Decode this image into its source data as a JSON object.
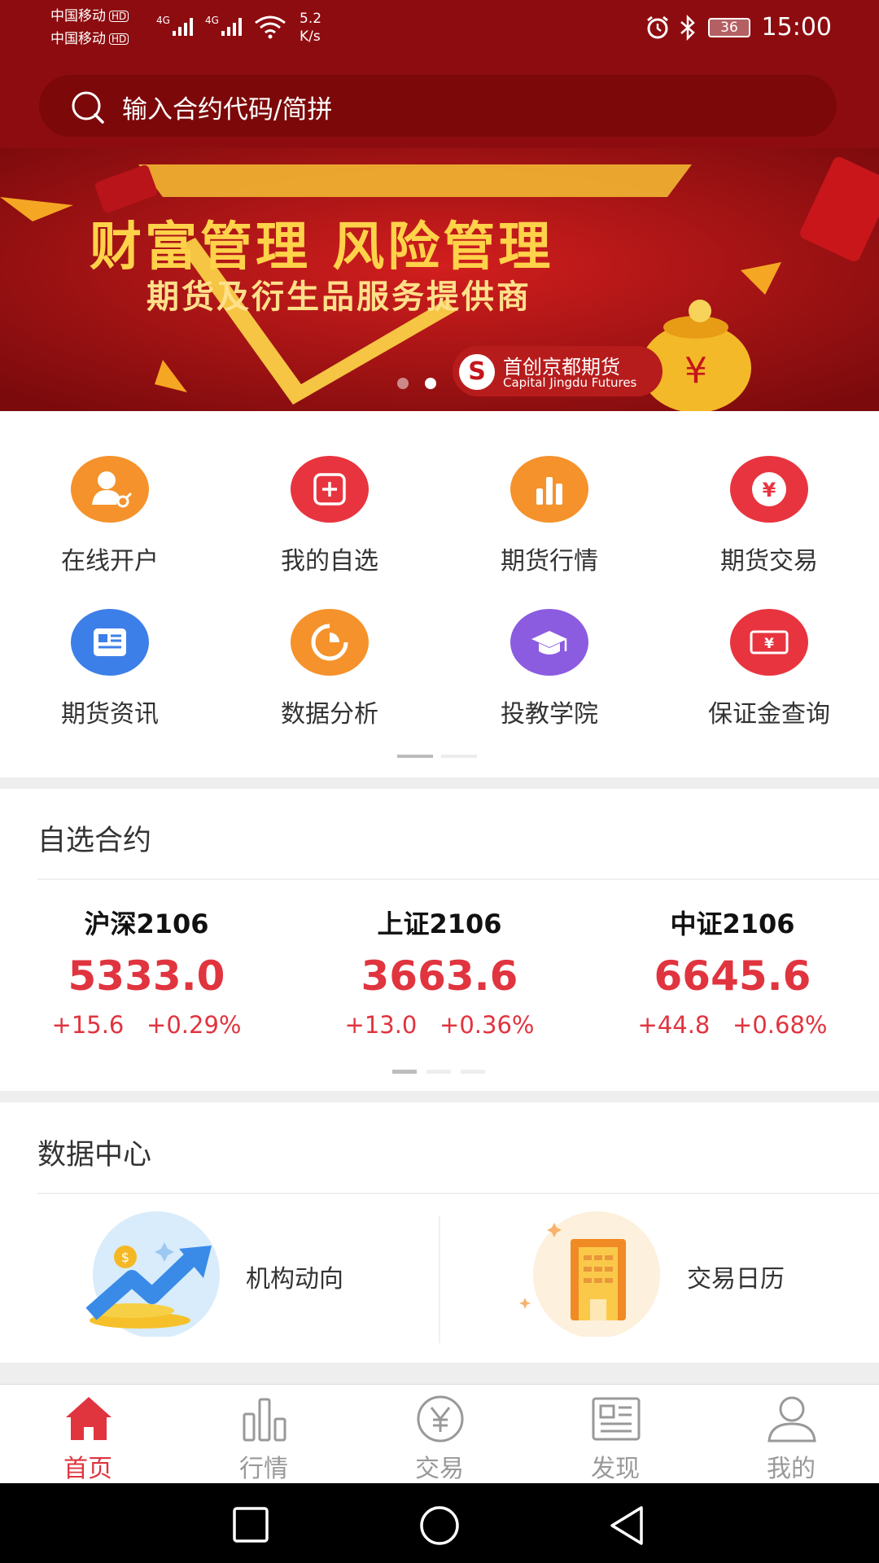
{
  "status_bar": {
    "carrier1": "中国移动",
    "carrier2": "中国移动",
    "hd": "HD",
    "net1": "4G",
    "net2": "4G",
    "speed": "5.2",
    "speed_unit": "K/s",
    "battery": "36",
    "time": "15:00"
  },
  "search": {
    "placeholder": "输入合约代码/简拼"
  },
  "banner": {
    "title": "财富管理 风险管理",
    "subtitle": "期货及衍生品服务提供商",
    "logo_cn": "首创京都期货",
    "logo_en": "Capital Jingdu Futures",
    "logo_mark": "S",
    "total_slides": 2,
    "active_slide": 2
  },
  "menu": [
    {
      "label": "在线开户",
      "icon": "open-account-icon",
      "color": "#f5922b"
    },
    {
      "label": "我的自选",
      "icon": "plus-square-icon",
      "color": "#e8343f"
    },
    {
      "label": "期货行情",
      "icon": "bar-chart-icon",
      "color": "#f5922b"
    },
    {
      "label": "期货交易",
      "icon": "yen-icon",
      "color": "#e8343f"
    },
    {
      "label": "期货资讯",
      "icon": "news-icon",
      "color": "#3d7fe8"
    },
    {
      "label": "数据分析",
      "icon": "pie-chart-icon",
      "color": "#f5922b"
    },
    {
      "label": "投教学院",
      "icon": "graduation-cap-icon",
      "color": "#8b5ce0"
    },
    {
      "label": "保证金查询",
      "icon": "bill-icon",
      "color": "#e8343f"
    }
  ],
  "watchlist": {
    "title": "自选合约",
    "items": [
      {
        "name": "沪深2106",
        "price": "5333.0",
        "change": "+15.6   +0.29%"
      },
      {
        "name": "上证2106",
        "price": "3663.6",
        "change": "+13.0   +0.36%"
      },
      {
        "name": "中证2106",
        "price": "6645.6",
        "change": "+44.8   +0.68%"
      }
    ]
  },
  "data_center": {
    "title": "数据中心",
    "items": [
      {
        "label": "机构动向",
        "icon": "trend-up-icon"
      },
      {
        "label": "交易日历",
        "icon": "calendar-building-icon"
      }
    ]
  },
  "tabs": [
    {
      "label": "首页",
      "icon": "home-icon",
      "active": true
    },
    {
      "label": "行情",
      "icon": "bars-icon",
      "active": false
    },
    {
      "label": "交易",
      "icon": "yen-circle-icon",
      "active": false
    },
    {
      "label": "发现",
      "icon": "newspaper-icon",
      "active": false
    },
    {
      "label": "我的",
      "icon": "user-icon",
      "active": false
    }
  ],
  "colors": {
    "brand": "#8d0c0f",
    "accent": "#e0343f",
    "tab_inactive": "#999999"
  }
}
